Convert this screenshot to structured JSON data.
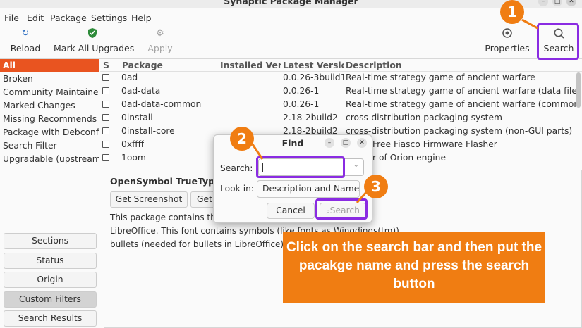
{
  "window": {
    "title": "Synaptic Package Manager",
    "minimize": "–",
    "maximize": "□",
    "close": "✕"
  },
  "menu": [
    "File",
    "Edit",
    "Package",
    "Settings",
    "Help"
  ],
  "toolbar": {
    "reload": "Reload",
    "mark_all": "Mark All Upgrades",
    "apply": "Apply",
    "properties": "Properties",
    "search": "Search"
  },
  "filters": [
    "All",
    "Broken",
    "Community Maintained (",
    "Marked Changes",
    "Missing Recommends",
    "Package with Debconf",
    "Search Filter",
    "Upgradable (upstream)"
  ],
  "left_buttons": [
    "Sections",
    "Status",
    "Origin",
    "Custom Filters",
    "Search Results"
  ],
  "columns": {
    "s": "S",
    "package": "Package",
    "installed": "Installed Versi",
    "latest": "Latest Version",
    "description": "Description"
  },
  "packages": [
    {
      "name": "0ad",
      "latest": "0.0.26-3build1",
      "description": "Real-time strategy game of ancient warfare"
    },
    {
      "name": "0ad-data",
      "latest": "0.0.26-1",
      "description": "Real-time strategy game of ancient warfare (data files)"
    },
    {
      "name": "0ad-data-common",
      "latest": "0.0.26-1",
      "description": "Real-time strategy game of ancient warfare (common data files)"
    },
    {
      "name": "0install",
      "latest": "2.18-2build2",
      "description": "cross-distribution packaging system"
    },
    {
      "name": "0install-core",
      "latest": "2.18-2build2",
      "description": "cross-distribution packaging system (non-GUI parts)"
    },
    {
      "name": "0xffff",
      "latest": "",
      "description": "Free Fiasco Firmware Flasher"
    },
    {
      "name": "1oom",
      "latest": "",
      "description": "r of Orion engine"
    }
  ],
  "details": {
    "title": "OpenSymbol TrueType",
    "get_screenshot": "Get Screenshot",
    "get_partial": "Get",
    "lines": [
      "This package contains the O",
      "LibreOffice. This font contains symbols (like fonts as Wingdings(tm))",
      "bullets (needed for bullets in LibreOffice) an"
    ]
  },
  "find_dialog": {
    "title": "Find",
    "search_label": "Search:",
    "search_value": "",
    "lookin_label": "Look in:",
    "lookin_value": "Description and Name",
    "cancel": "Cancel",
    "search_button": "Search"
  },
  "annotations": {
    "badge1": "1",
    "badge2": "2",
    "badge3": "3",
    "callout": "Click on the search bar and then put the pacakge name and press the search button"
  },
  "colors": {
    "accent": "#e95420",
    "highlight": "#8a2be2",
    "annotation": "#f07d12"
  }
}
